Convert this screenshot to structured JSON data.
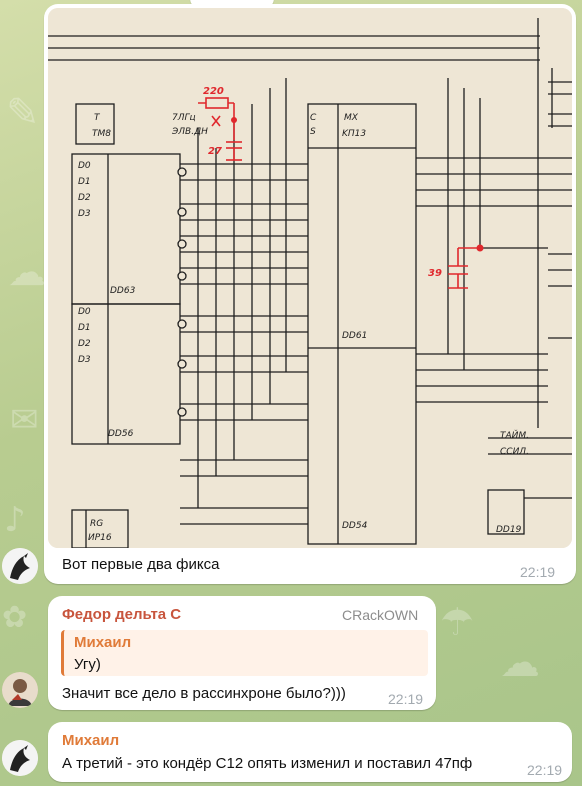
{
  "messages": [
    {
      "caption": "Вот первые два фикса",
      "time": "22:19",
      "photo": {
        "description_icon": "schematic-photo",
        "labels": [
          "T",
          "TM8",
          "D0",
          "D1",
          "D2",
          "D3",
          "DD63",
          "DD56",
          "MX",
          "KП13",
          "DD61",
          "DD54",
          "RG",
          "ИР16",
          "220",
          "27",
          "39",
          "ТАЙМ.",
          "ССИЛ.",
          "DD19",
          "7ЛГц",
          "ЭЛВ.ДН",
          "C",
          "S"
        ]
      }
    },
    {
      "sender": "Федор дельта С",
      "sender_tag": "CRackOWN",
      "quote_author": "Михаил",
      "quote_text": "Угу)",
      "text": "Значит все дело в рассинхроне было?)))",
      "time": "22:19"
    },
    {
      "sender": "Михаил",
      "text": "А третий - это кондёр С12 опять изменил и поставил 47пф",
      "time": "22:19"
    }
  ],
  "colors": {
    "sender_orange": "#e07b39",
    "sender_red": "#c8553d",
    "tag_gray": "#8c8c8c",
    "time_gray": "#a3aab0",
    "ink_red": "#e0282d"
  }
}
